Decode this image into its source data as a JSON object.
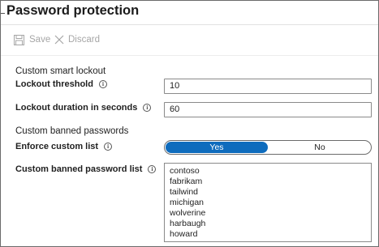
{
  "window": {
    "title": "Password protection"
  },
  "toolbar": {
    "save_label": "Save",
    "discard_label": "Discard"
  },
  "smart_lockout": {
    "heading": "Custom smart lockout",
    "threshold_label": "Lockout threshold",
    "threshold_value": "10",
    "duration_label": "Lockout duration in seconds",
    "duration_value": "60"
  },
  "banned_passwords": {
    "heading": "Custom banned passwords",
    "enforce_label": "Enforce custom list",
    "enforce_options": [
      "Yes",
      "No"
    ],
    "enforce_selected": "Yes",
    "list_label": "Custom banned password list",
    "list_items": [
      "contoso",
      "fabrikam",
      "tailwind",
      "michigan",
      "wolverine",
      "harbaugh",
      "howard"
    ]
  },
  "colors": {
    "accent": "#0f6cbd",
    "disabled_text": "#a6a6a6",
    "border": "#8a8a8a"
  },
  "icons": {
    "save": "save-icon",
    "discard": "close-icon",
    "info": "info-icon"
  }
}
